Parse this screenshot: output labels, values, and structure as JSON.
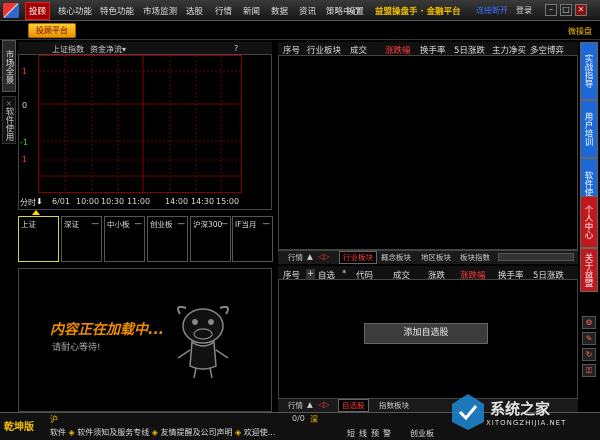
{
  "menu": {
    "items": [
      "投顾",
      "核心功能",
      "特色功能",
      "市场监测",
      "选股",
      "行情",
      "新闻",
      "数据",
      "资讯",
      "策略中心",
      "设置"
    ],
    "brand": "益盟操盘手 · 金融平台",
    "connect": "连接断开",
    "login": "登录"
  },
  "subbar": {
    "platform": "投顾平台",
    "weipan": "微操盘"
  },
  "left_tabs": {
    "market": "市场全景",
    "software": "软件使用"
  },
  "chart": {
    "title": "上证指数",
    "flow": "资金净流▾",
    "help": "?",
    "yticks": [
      "1",
      "0",
      "-1",
      "1"
    ],
    "ytick_colors": [
      "#ff3c3c",
      "#dddddd",
      "#3cdc3c",
      "#ff3c3c"
    ],
    "xticks": [
      "分时",
      "6/01",
      "10:00",
      "10:30",
      "11:00",
      "14:00",
      "14:30",
      "15:00"
    ]
  },
  "tiles": [
    {
      "label": "上证",
      "dash": "—"
    },
    {
      "label": "深证",
      "dash": "—"
    },
    {
      "label": "中小板",
      "dash": "—"
    },
    {
      "label": "创业板",
      "dash": "—"
    },
    {
      "label": "沪深300",
      "dash": "—"
    },
    {
      "label": "IF当月",
      "dash": "—"
    }
  ],
  "loading": {
    "title": "内容正在加载中...",
    "subtitle": "请耐心等待!"
  },
  "top_table": {
    "headers": [
      "序号",
      "行业板块",
      "成交",
      "涨跌幅",
      "换手率",
      "5日涨跌",
      "主力净买",
      "多空博弈"
    ],
    "tabs": [
      "行情",
      "▲",
      "行业板块",
      "概念板块",
      "地区板块",
      "板块指数"
    ]
  },
  "bottom_table": {
    "headers": [
      "序号",
      "+",
      "自选",
      "*",
      "代码",
      "成交",
      "涨跌",
      "涨跌幅",
      "换手率",
      "5日涨跌"
    ],
    "add_button": "添加自选股",
    "tabs": [
      "行情",
      "▲",
      "自选股",
      "指数板块"
    ]
  },
  "right_tabs": [
    {
      "label": "实战指导",
      "color": "#1c68d6"
    },
    {
      "label": "用户培训",
      "color": "#1c68d6"
    },
    {
      "label": "软件使用",
      "color": "#1c68d6"
    },
    {
      "label": "个人中心",
      "color": "#c2181d"
    },
    {
      "label": "关于益盟",
      "color": "#c2181d"
    }
  ],
  "right_icons": [
    "gear-icon",
    "tool-icon",
    "refresh-icon",
    "lock-icon"
  ],
  "bottom": {
    "product": "乾坤版",
    "sh": "沪",
    "sz": "深",
    "sz_val": "0/0",
    "ticker_items": [
      "软件",
      "软件须知及服务专线",
      "友情提醒及公司声明",
      "欢迎使..."
    ],
    "alerts": "短线预警",
    "cyb": "创业板"
  },
  "watermark": {
    "text": "系统之家",
    "sub": "XITONGZHIJIA.NET"
  }
}
